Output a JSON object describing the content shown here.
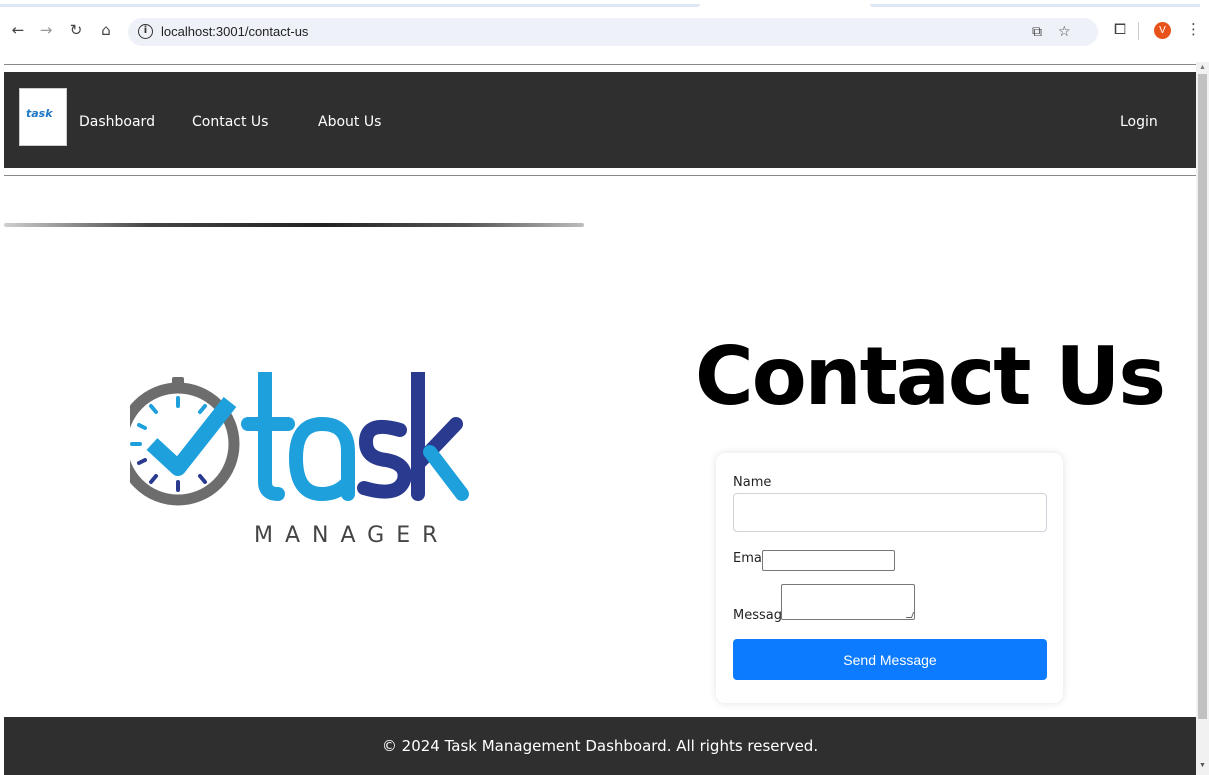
{
  "browser": {
    "url": "localhost:3001/contact-us",
    "profile_initial": "V"
  },
  "header": {
    "logo_text": "task",
    "nav": [
      {
        "label": "Dashboard"
      },
      {
        "label": "Contact Us"
      },
      {
        "label": "About Us"
      }
    ],
    "login_label": "Login"
  },
  "logo": {
    "word": "task",
    "subtitle": "MANAGER",
    "colors": {
      "dark_blue": "#2a3a8f",
      "light_blue": "#1ea0dc",
      "gray": "#6d6d6d"
    }
  },
  "contact": {
    "title": "Contact Us",
    "name_label": "Name",
    "email_label": "Email",
    "message_label": "Message",
    "name_value": "",
    "email_value": "",
    "message_value": "",
    "submit_label": "Send Message"
  },
  "footer": {
    "text": "© 2024 Task Management Dashboard. All rights reserved."
  },
  "colors": {
    "header_bg": "#2f2f2f",
    "button_bg": "#0d7bff"
  }
}
